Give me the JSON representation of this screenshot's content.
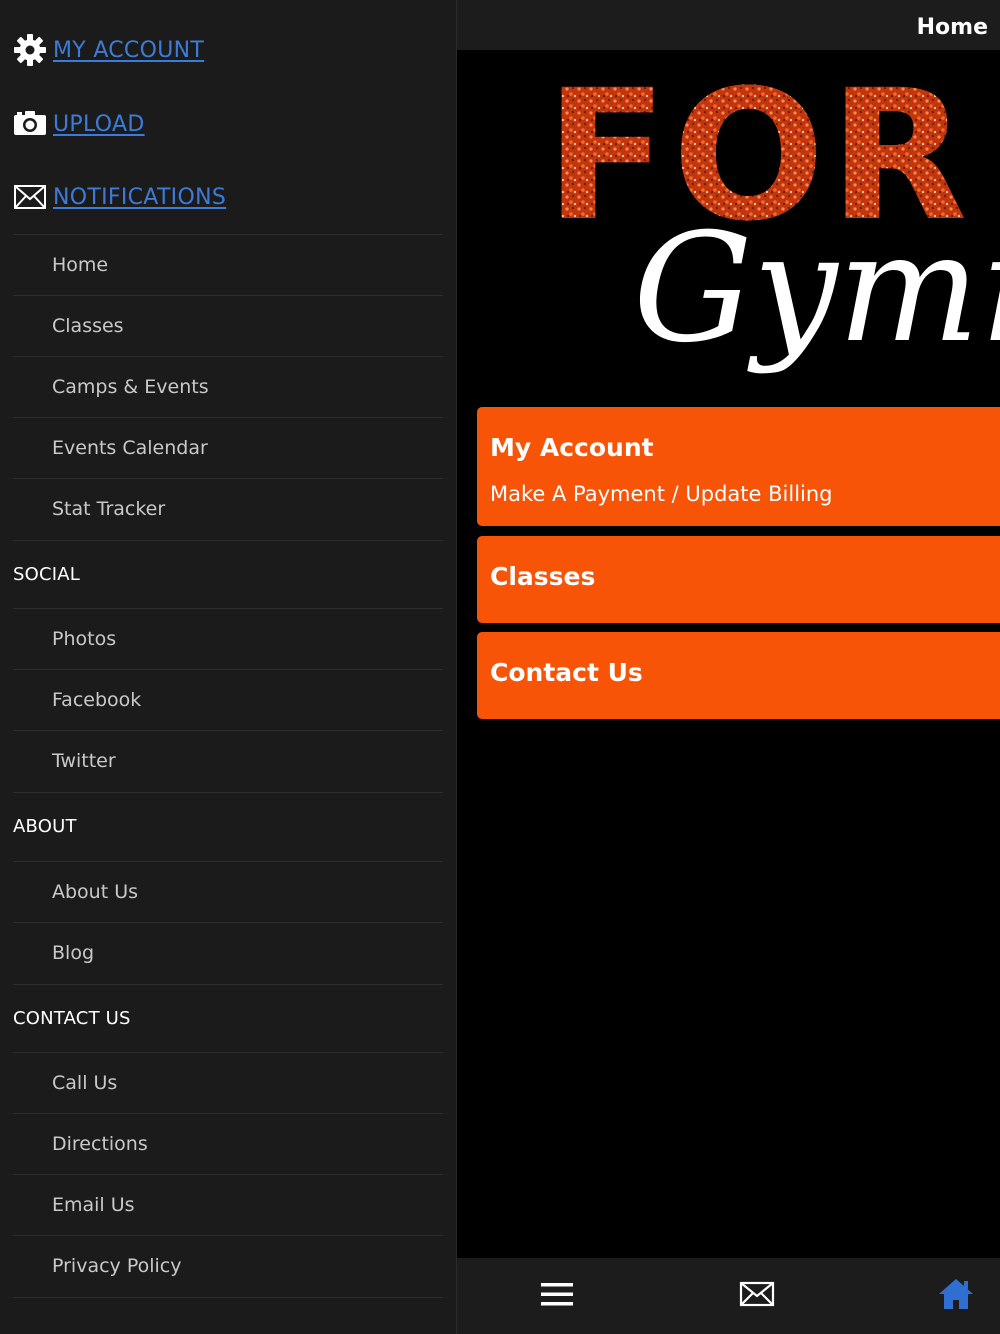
{
  "sidebar": {
    "top_links": [
      {
        "label": "MY ACCOUNT",
        "icon": "gear-icon"
      },
      {
        "label": "UPLOAD",
        "icon": "camera-icon"
      },
      {
        "label": "NOTIFICATIONS",
        "icon": "envelope-icon"
      }
    ],
    "main_items": [
      "Home",
      "Classes",
      "Camps & Events",
      "Events Calendar",
      "Stat Tracker"
    ],
    "sections": [
      {
        "title": "SOCIAL",
        "items": [
          "Photos",
          "Facebook",
          "Twitter"
        ]
      },
      {
        "title": "ABOUT",
        "items": [
          "About Us",
          "Blog"
        ]
      },
      {
        "title": "CONTACT US",
        "items": [
          "Call Us",
          "Directions",
          "Email Us",
          "Privacy Policy"
        ]
      }
    ]
  },
  "header": {
    "title": "Home"
  },
  "logo": {
    "word1": "FOR",
    "word2": "Gymn"
  },
  "cards": [
    {
      "title": "My Account",
      "subtitle": "Make A Payment / Update Billing"
    },
    {
      "title": "Classes"
    },
    {
      "title": "Contact Us"
    }
  ],
  "bottom_tabs": [
    {
      "icon": "menu-icon"
    },
    {
      "icon": "envelope-icon"
    },
    {
      "icon": "home-icon"
    }
  ],
  "colors": {
    "accent": "#f75408",
    "link": "#3d7bd9",
    "home_active": "#2f6fd1",
    "sidebar_bg": "#1b1b1b"
  }
}
